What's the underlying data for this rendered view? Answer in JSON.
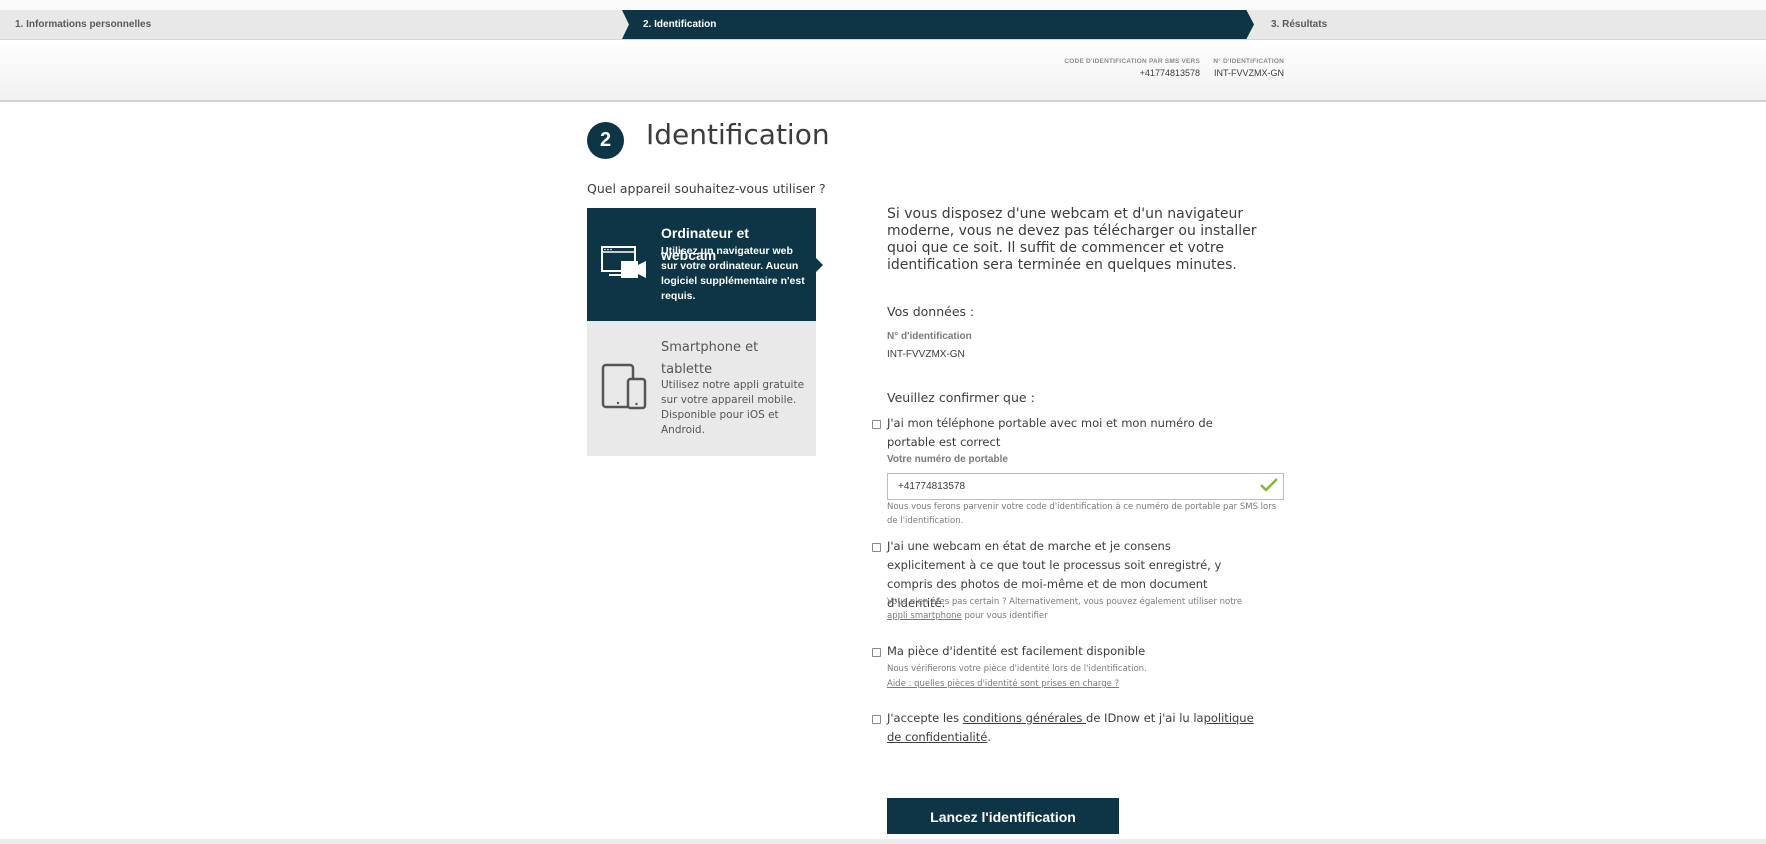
{
  "steps": {
    "step1": "1. Informations personnelles",
    "step2": "2. Identification",
    "step3": "3. Résultats"
  },
  "header": {
    "sms_label": "CODE D'IDENTIFICATION PAR SMS VERS",
    "sms_value": "+41774813578",
    "id_label": "N° D'IDENTIFICATION",
    "id_value": "INT-FVVZMX-GN"
  },
  "section": {
    "number": "2",
    "title": "Identification",
    "question": "Quel appareil souhaitez-vous utiliser ?"
  },
  "options": {
    "web": {
      "title": "Ordinateur et webcam",
      "desc": "Utilisez un navigateur web sur votre ordinateur. Aucun logiciel supplémentaire n'est requis.",
      "icon": "monitor-webcam-icon"
    },
    "mobile": {
      "title": "Smartphone et tablette",
      "desc": "Utilisez notre appli gratuite sur votre appareil mobile. Disponible pour iOS et Android.",
      "icon": "tablet-phone-icon"
    }
  },
  "intro": "Si vous disposez d'une webcam et d'un navigateur moderne, vous ne devez pas télécharger ou installer quoi que ce soit. Il suffit de commencer et votre identification sera terminée en quelques minutes.",
  "data_section": {
    "label": "Vos données :",
    "id_label": "N° d'identification",
    "id_value": "INT-FVVZMX-GN"
  },
  "confirm": {
    "label": "Veuillez confirmer que :",
    "phone": {
      "text": "J'ai mon téléphone portable avec moi et mon numéro de portable est correct",
      "field_label": "Votre numéro de portable",
      "value": "+41774813578",
      "note": "Nous vous ferons parvenir votre code d'identification à ce numéro de portable par SMS lors de l'identification."
    },
    "webcam": {
      "text": "J'ai une webcam en état de marche et je consens explicitement à ce que tout le processus soit enregistré, y compris des photos de moi-même et de mon document d'identité.",
      "note_before": "Vous n'en êtes pas certain ? Alternativement, vous pouvez également utiliser notre ",
      "note_link": "appli smartphone",
      "note_after": " pour vous identifier"
    },
    "idcard": {
      "text": "Ma pièce d'identité est facilement disponible",
      "note": "Nous vérifierons votre pièce d'identité lors de l'identification.",
      "link": "Aide : quelles pièces d'identité sont prises en charge ?"
    },
    "terms": {
      "before": "J'accepte les ",
      "link1": "conditions générales ",
      "middle": "de IDnow et j'ai lu la",
      "link2": "politique de confidentialité",
      "after": "."
    }
  },
  "cta": "Lancez l'identification",
  "colors": {
    "primary": "#0e3546",
    "valid_check": "#8ab53a"
  }
}
